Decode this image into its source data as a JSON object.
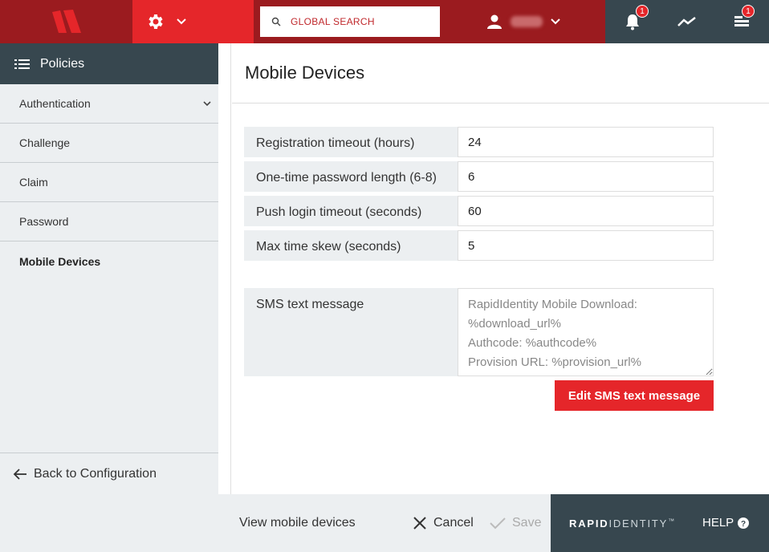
{
  "header": {
    "search_placeholder": "GLOBAL SEARCH",
    "notifications_count": "1",
    "tasks_count": "1"
  },
  "sidebar": {
    "title": "Policies",
    "items": [
      {
        "label": "Authentication"
      },
      {
        "label": "Challenge"
      },
      {
        "label": "Claim"
      },
      {
        "label": "Password"
      },
      {
        "label": "Mobile Devices"
      }
    ],
    "back_label": "Back to Configuration"
  },
  "main": {
    "title": "Mobile Devices",
    "fields": [
      {
        "label": "Registration timeout (hours)",
        "value": "24"
      },
      {
        "label": "One-time password length (6-8)",
        "value": "6"
      },
      {
        "label": "Push login timeout (seconds)",
        "value": "60"
      },
      {
        "label": "Max time skew (seconds)",
        "value": "5"
      }
    ],
    "sms_label": "SMS text message",
    "sms_placeholder": "RapidIdentity Mobile Download: %download_url%\nAuthcode: %authcode%\nProvision URL: %provision_url%",
    "edit_sms_label": "Edit SMS text message"
  },
  "footer": {
    "view_devices_label": "View mobile devices",
    "cancel_label": "Cancel",
    "save_label": "Save",
    "brand_bold": "RAPID",
    "brand_light": "IDENTITY",
    "brand_tm": "™",
    "help_label": "HELP"
  },
  "colors": {
    "brand_red": "#e5262a",
    "dark_red": "#9b1b1f",
    "slate": "#37474f",
    "panel_gray": "#eceff1"
  }
}
